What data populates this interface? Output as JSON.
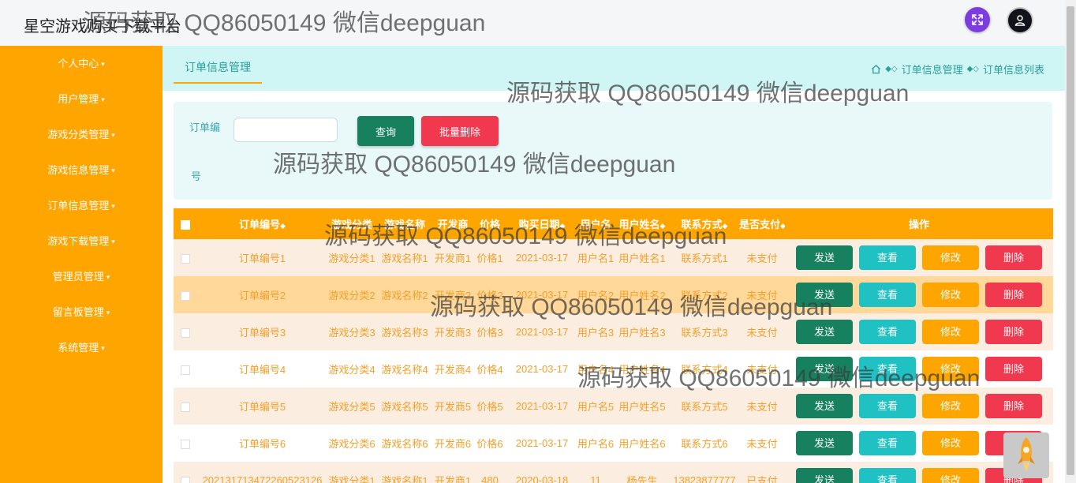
{
  "header": {
    "brand": "星空游戏购买下载平台",
    "fullscreen_icon": "fullscreen-icon",
    "user_icon": "user-avatar-icon"
  },
  "sidebar": {
    "items": [
      {
        "label": "个人中心"
      },
      {
        "label": "用户管理"
      },
      {
        "label": "游戏分类管理"
      },
      {
        "label": "游戏信息管理"
      },
      {
        "label": "订单信息管理"
      },
      {
        "label": "游戏下载管理"
      },
      {
        "label": "管理员管理"
      },
      {
        "label": "留言板管理"
      },
      {
        "label": "系统管理"
      }
    ]
  },
  "tabs": {
    "active": "订单信息管理"
  },
  "breadcrumb": {
    "level1": "订单信息管理",
    "level2": "订单信息列表"
  },
  "search": {
    "label_line1": "订单编",
    "label_line2": "号",
    "value": "",
    "query_label": "查询",
    "batch_delete_label": "批量删除"
  },
  "table": {
    "headers": [
      "订单编号",
      "游戏分类",
      "游戏名称",
      "开发商",
      "价格",
      "购买日期",
      "用户名",
      "用户姓名",
      "联系方式",
      "是否支付",
      "操作"
    ],
    "actions": {
      "send": "发送",
      "view": "查看",
      "edit": "修改",
      "delete": "删除"
    },
    "rows": [
      [
        "订单编号1",
        "游戏分类1",
        "游戏名称1",
        "开发商1",
        "价格1",
        "2021-03-17",
        "用户名1",
        "用户姓名1",
        "联系方式1",
        "未支付"
      ],
      [
        "订单编号2",
        "游戏分类2",
        "游戏名称2",
        "开发商2",
        "价格2",
        "2021-03-17",
        "用户名2",
        "用户姓名2",
        "联系方式2",
        "未支付"
      ],
      [
        "订单编号3",
        "游戏分类3",
        "游戏名称3",
        "开发商3",
        "价格3",
        "2021-03-17",
        "用户名3",
        "用户姓名3",
        "联系方式3",
        "未支付"
      ],
      [
        "订单编号4",
        "游戏分类4",
        "游戏名称4",
        "开发商4",
        "价格4",
        "2021-03-17",
        "用户名4",
        "用户姓名4",
        "联系方式4",
        "未支付"
      ],
      [
        "订单编号5",
        "游戏分类5",
        "游戏名称5",
        "开发商5",
        "价格5",
        "2021-03-17",
        "用户名5",
        "用户姓名5",
        "联系方式5",
        "未支付"
      ],
      [
        "订单编号6",
        "游戏分类6",
        "游戏名称6",
        "开发商6",
        "价格6",
        "2021-03-17",
        "用户名6",
        "用户姓名6",
        "联系方式6",
        "未支付"
      ],
      [
        "202131713472260523126",
        "游戏分类1",
        "游戏名称1",
        "开发商1",
        "480",
        "2020-03-18",
        "11",
        "杨先生",
        "13823877777",
        "已支付"
      ]
    ]
  },
  "watermark": "源码获取 QQ86050149 微信deepguan",
  "colors": {
    "sidebar": "#fea500",
    "accent": "#2a9f9b",
    "send": "#17815f",
    "view": "#1fc1c3",
    "edit": "#fea500",
    "delete": "#f0394f"
  }
}
